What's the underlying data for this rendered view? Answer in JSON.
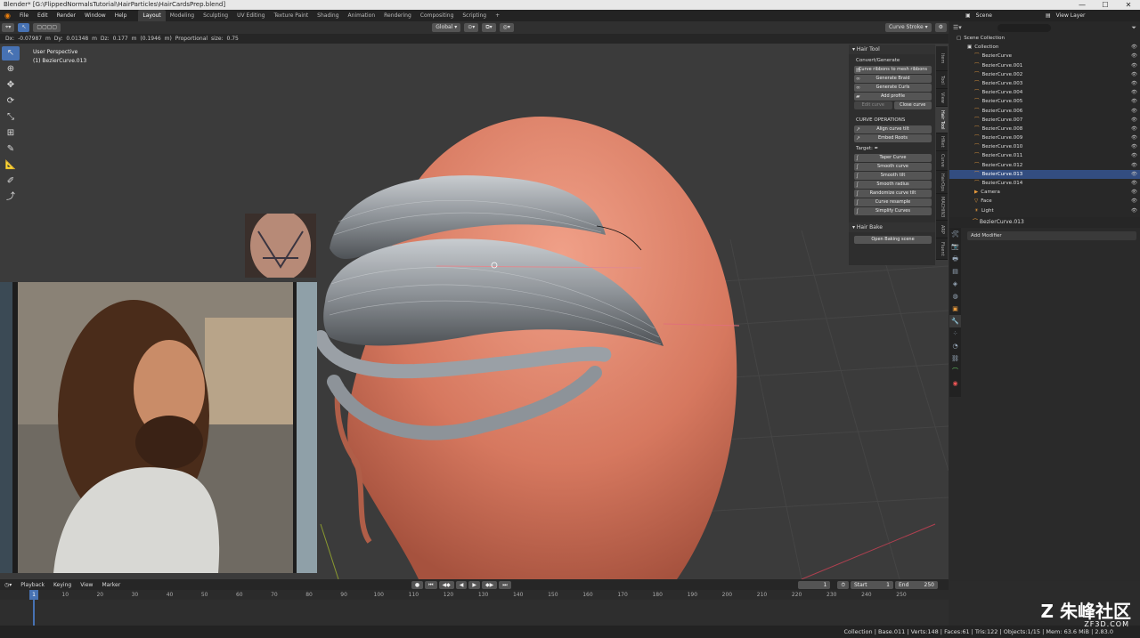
{
  "window": {
    "title": "Blender* [G:\\FlippedNormalsTutorial\\HairParticles\\HairCardsPrep.blend]",
    "controls": [
      "—",
      "☐",
      "✕"
    ]
  },
  "menu": [
    "File",
    "Edit",
    "Render",
    "Window",
    "Help"
  ],
  "workspaces": [
    "Layout",
    "Modeling",
    "Sculpting",
    "UV Editing",
    "Texture Paint",
    "Shading",
    "Animation",
    "Rendering",
    "Compositing",
    "Scripting",
    "+"
  ],
  "top_right": {
    "scene_label": "Scene",
    "view_layer_label": "View Layer"
  },
  "header": {
    "orientation": "Global",
    "mode": "Curve Stroke"
  },
  "op_info": "Dx: -0.07987 m  Dy: 0.01348 m  Dz: 0.177 m (0.1946 m)    Proportional size: 0.75",
  "viewport": {
    "perspective": "User Perspective",
    "object": "(1) BezierCurve.013"
  },
  "tabs": [
    "Item",
    "Tool",
    "View",
    "Hair Tool",
    "HNet",
    "Curve",
    "HairOps",
    "MACHIN3",
    "ARP",
    "Fluent"
  ],
  "hair_tool": {
    "title": "Hair Tool",
    "section1": "Convert/Generate",
    "buttons1": [
      "Curve ribbons to mesh ribbons",
      "Generate Braid",
      "Generate Curls",
      "Add profile"
    ],
    "edit_curve": "Edit curve",
    "close_curve": "Close curve",
    "section2": "CURVE OPERATIONS",
    "buttons2": [
      "Align curve tilt",
      "Embed Roots"
    ],
    "target_label": "Target:",
    "buttons3": [
      "Taper Curve",
      "Smooth curve",
      "Smooth tilt",
      "Smooth radius",
      "Randomize curve tilt",
      "Curve resample",
      "Simplify Curves"
    ]
  },
  "hair_bake": {
    "title": "Hair Bake",
    "button": "Open Baking scene"
  },
  "outliner": {
    "root": "Scene Collection",
    "collection": "Collection",
    "items": [
      "BezierCurve",
      "BezierCurve.001",
      "BezierCurve.002",
      "BezierCurve.003",
      "BezierCurve.004",
      "BezierCurve.005",
      "BezierCurve.006",
      "BezierCurve.007",
      "BezierCurve.008",
      "BezierCurve.009",
      "BezierCurve.010",
      "BezierCurve.011",
      "BezierCurve.012",
      "BezierCurve.013",
      "BezierCurve.014",
      "Camera",
      "Face",
      "Light"
    ],
    "selected_index": 13
  },
  "properties": {
    "object": "BezierCurve.013",
    "add_modifier": "Add Modifier"
  },
  "timeline": {
    "menus": [
      "Playback",
      "Keying",
      "View",
      "Marker"
    ],
    "current_frame": "1",
    "start_label": "Start",
    "start": "1",
    "end_label": "End",
    "end": "250",
    "ticks": [
      "1",
      "10",
      "20",
      "30",
      "40",
      "50",
      "60",
      "70",
      "80",
      "90",
      "100",
      "110",
      "120",
      "130",
      "140",
      "150",
      "160",
      "170",
      "180",
      "190",
      "200",
      "210",
      "220",
      "230",
      "240",
      "250"
    ]
  },
  "status": "Collection | Base.011 | Verts:148 | Faces:61 | Tris:122 | Objects:1/15 | Mem: 63.6 MiB | 2.83.0",
  "watermark": {
    "main": "朱峰社区",
    "sub": "ZF3D.COM"
  },
  "colors": {
    "accent": "#4772b3",
    "selected_row": "#334d80",
    "skin": "#d8836a",
    "hair": "#b5b9bd"
  }
}
